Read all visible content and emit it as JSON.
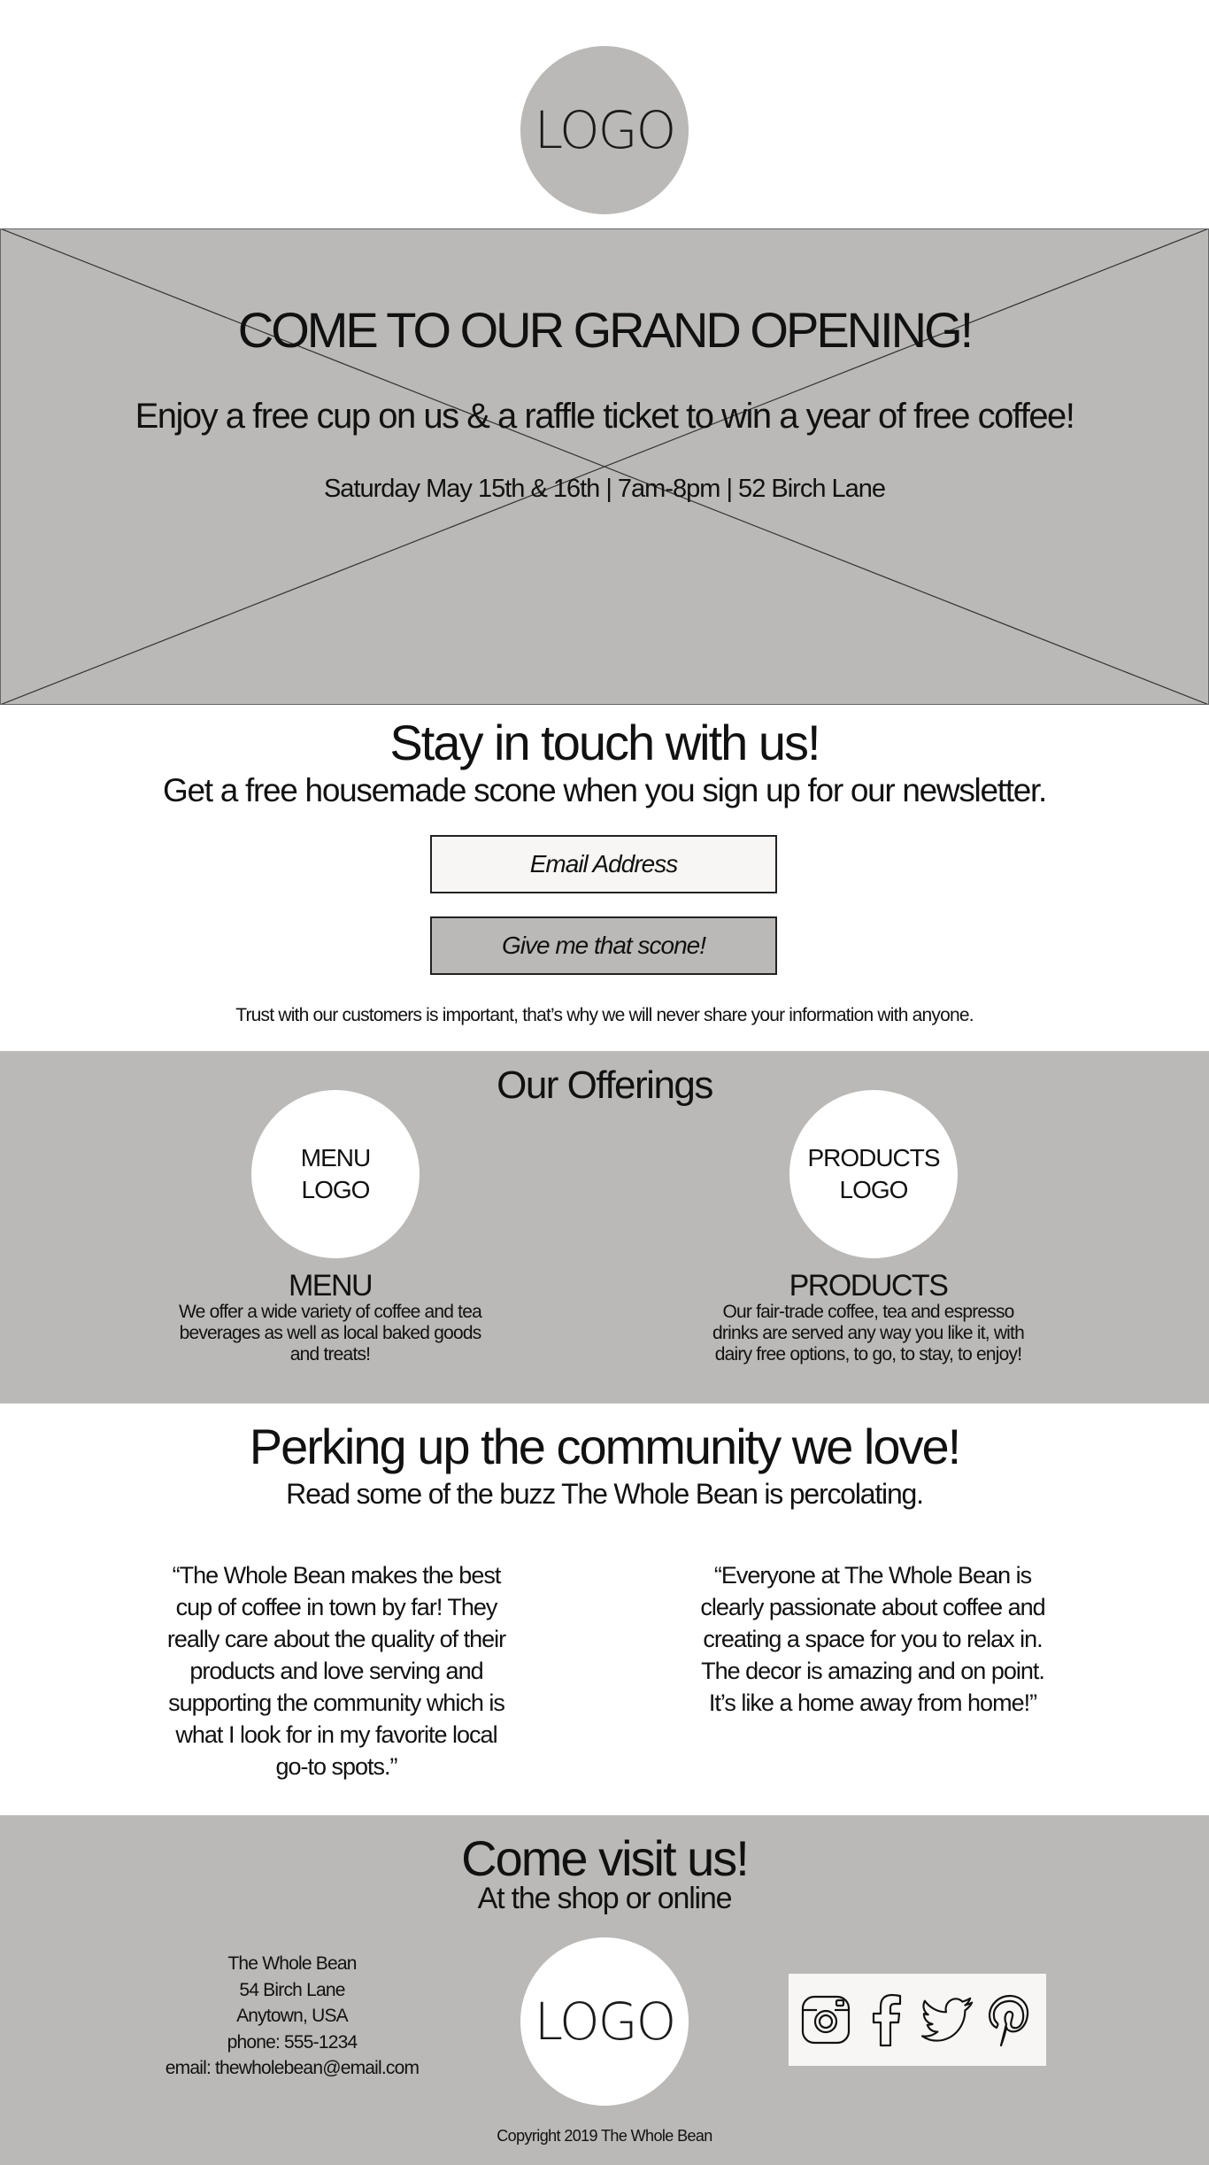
{
  "header": {
    "logo_text": "LOGO"
  },
  "hero": {
    "title": "COME TO OUR GRAND OPENING!",
    "subtitle": "Enjoy a free cup on us & a raffle ticket to win a year of free coffee!",
    "details": "Saturday May 15th & 16th | 7am-8pm | 52 Birch Lane"
  },
  "newsletter": {
    "title": "Stay in touch with us!",
    "subtitle": "Get a free housemade scone when you sign up for our newsletter.",
    "email_placeholder": "Email Address",
    "button_label": "Give me that scone!",
    "privacy_note": "Trust with our customers is important, that’s why we will never share your information with anyone."
  },
  "offerings": {
    "title": "Our Offerings",
    "items": [
      {
        "logo_text": "MENU\nLOGO",
        "name": "MENU",
        "description": "We offer a wide variety of coffee and tea beverages as well as local baked goods and treats!"
      },
      {
        "logo_text": "PRODUCTS\nLOGO",
        "name": "PRODUCTS",
        "description": "Our fair-trade coffee, tea and espresso drinks are served any way you like it, with dairy free options, to go, to stay, to enjoy!"
      }
    ]
  },
  "community": {
    "title": "Perking up the community we love!",
    "subtitle": "Read some of the buzz The Whole Bean is percolating.",
    "quotes": [
      "“The Whole Bean makes the best cup of coffee in town by far! They really care about the quality of their products and love serving and supporting the community which is what I look for in my favorite local go-to spots.”",
      "“Everyone at The Whole Bean is clearly passionate about coffee and creating a space for you to relax in. The decor is amazing and on point. It’s like a home away from home!”"
    ]
  },
  "footer": {
    "title": "Come visit us!",
    "subtitle": "At the shop or online",
    "address": {
      "name": "The Whole Bean",
      "street": "54 Birch Lane",
      "city": "Anytown, USA",
      "phone": "phone: 555-1234",
      "email": "email: thewholebean@email.com"
    },
    "logo_text": "LOGO",
    "social_icons": [
      "instagram-icon",
      "facebook-icon",
      "twitter-icon",
      "pinterest-icon"
    ],
    "copyright": "Copyright 2019 The Whole Bean"
  },
  "colors": {
    "gray_panel": "#bab9b7",
    "white": "#ffffff",
    "off_white": "#f7f6f4",
    "text": "#111111"
  }
}
